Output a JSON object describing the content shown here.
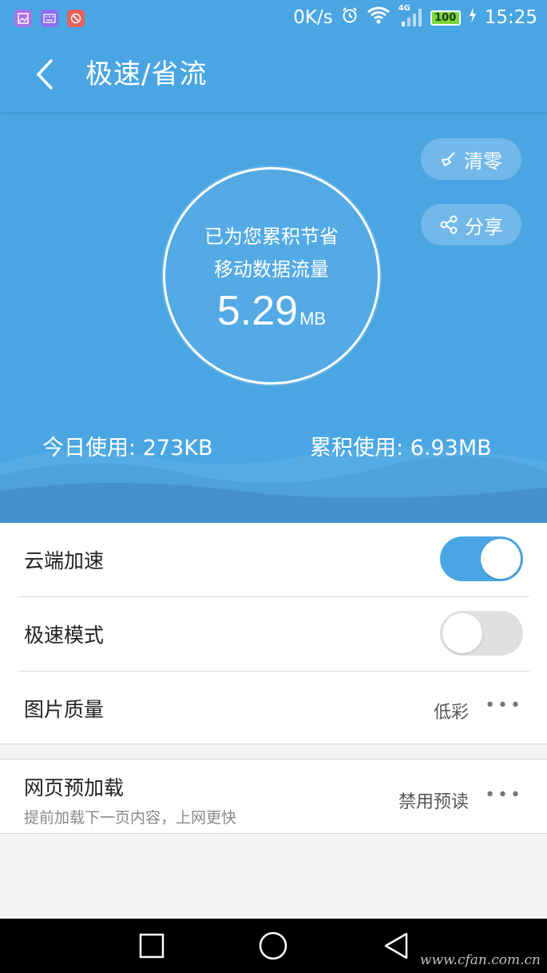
{
  "status": {
    "net_speed": "0K/s",
    "signal_label": "4G",
    "battery": "100",
    "time": "15:25"
  },
  "header": {
    "title": "极速/省流"
  },
  "hero": {
    "line1": "已为您累积节省",
    "line2": "移动数据流量",
    "value": "5.29",
    "unit": "MB",
    "clear_label": "清零",
    "share_label": "分享",
    "today_label": "今日使用:",
    "today_value": "273KB",
    "total_label": "累积使用:",
    "total_value": "6.93MB"
  },
  "settings": {
    "cloud_accel": {
      "label": "云端加速",
      "enabled": true
    },
    "fast_mode": {
      "label": "极速模式",
      "enabled": false
    },
    "image_quality": {
      "label": "图片质量",
      "value": "低彩"
    },
    "preload": {
      "label": "网页预加载",
      "sublabel": "提前加载下一页内容，上网更快",
      "value": "禁用预读"
    }
  },
  "more_dots": "•••",
  "watermark": "www.cfan.com.cn",
  "colors": {
    "accent": "#4aa6e3",
    "toggle_off": "#e0e0e0"
  }
}
